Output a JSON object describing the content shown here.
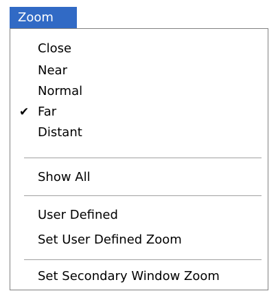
{
  "menu": {
    "title": "Zoom",
    "items": [
      {
        "label": "Close",
        "checked": false
      },
      {
        "label": "Near",
        "checked": false
      },
      {
        "label": "Normal",
        "checked": false
      },
      {
        "label": "Far",
        "checked": true
      },
      {
        "label": "Distant",
        "checked": false
      },
      {
        "label": "Show All",
        "checked": false
      },
      {
        "label": "User Defined",
        "checked": false
      },
      {
        "label": "Set User Defined Zoom",
        "checked": false
      },
      {
        "label": "Set Secondary Window Zoom",
        "checked": false
      }
    ],
    "check_glyph": "✔",
    "check_icon": "checkmark-icon",
    "accent_color": "#316ac5"
  }
}
